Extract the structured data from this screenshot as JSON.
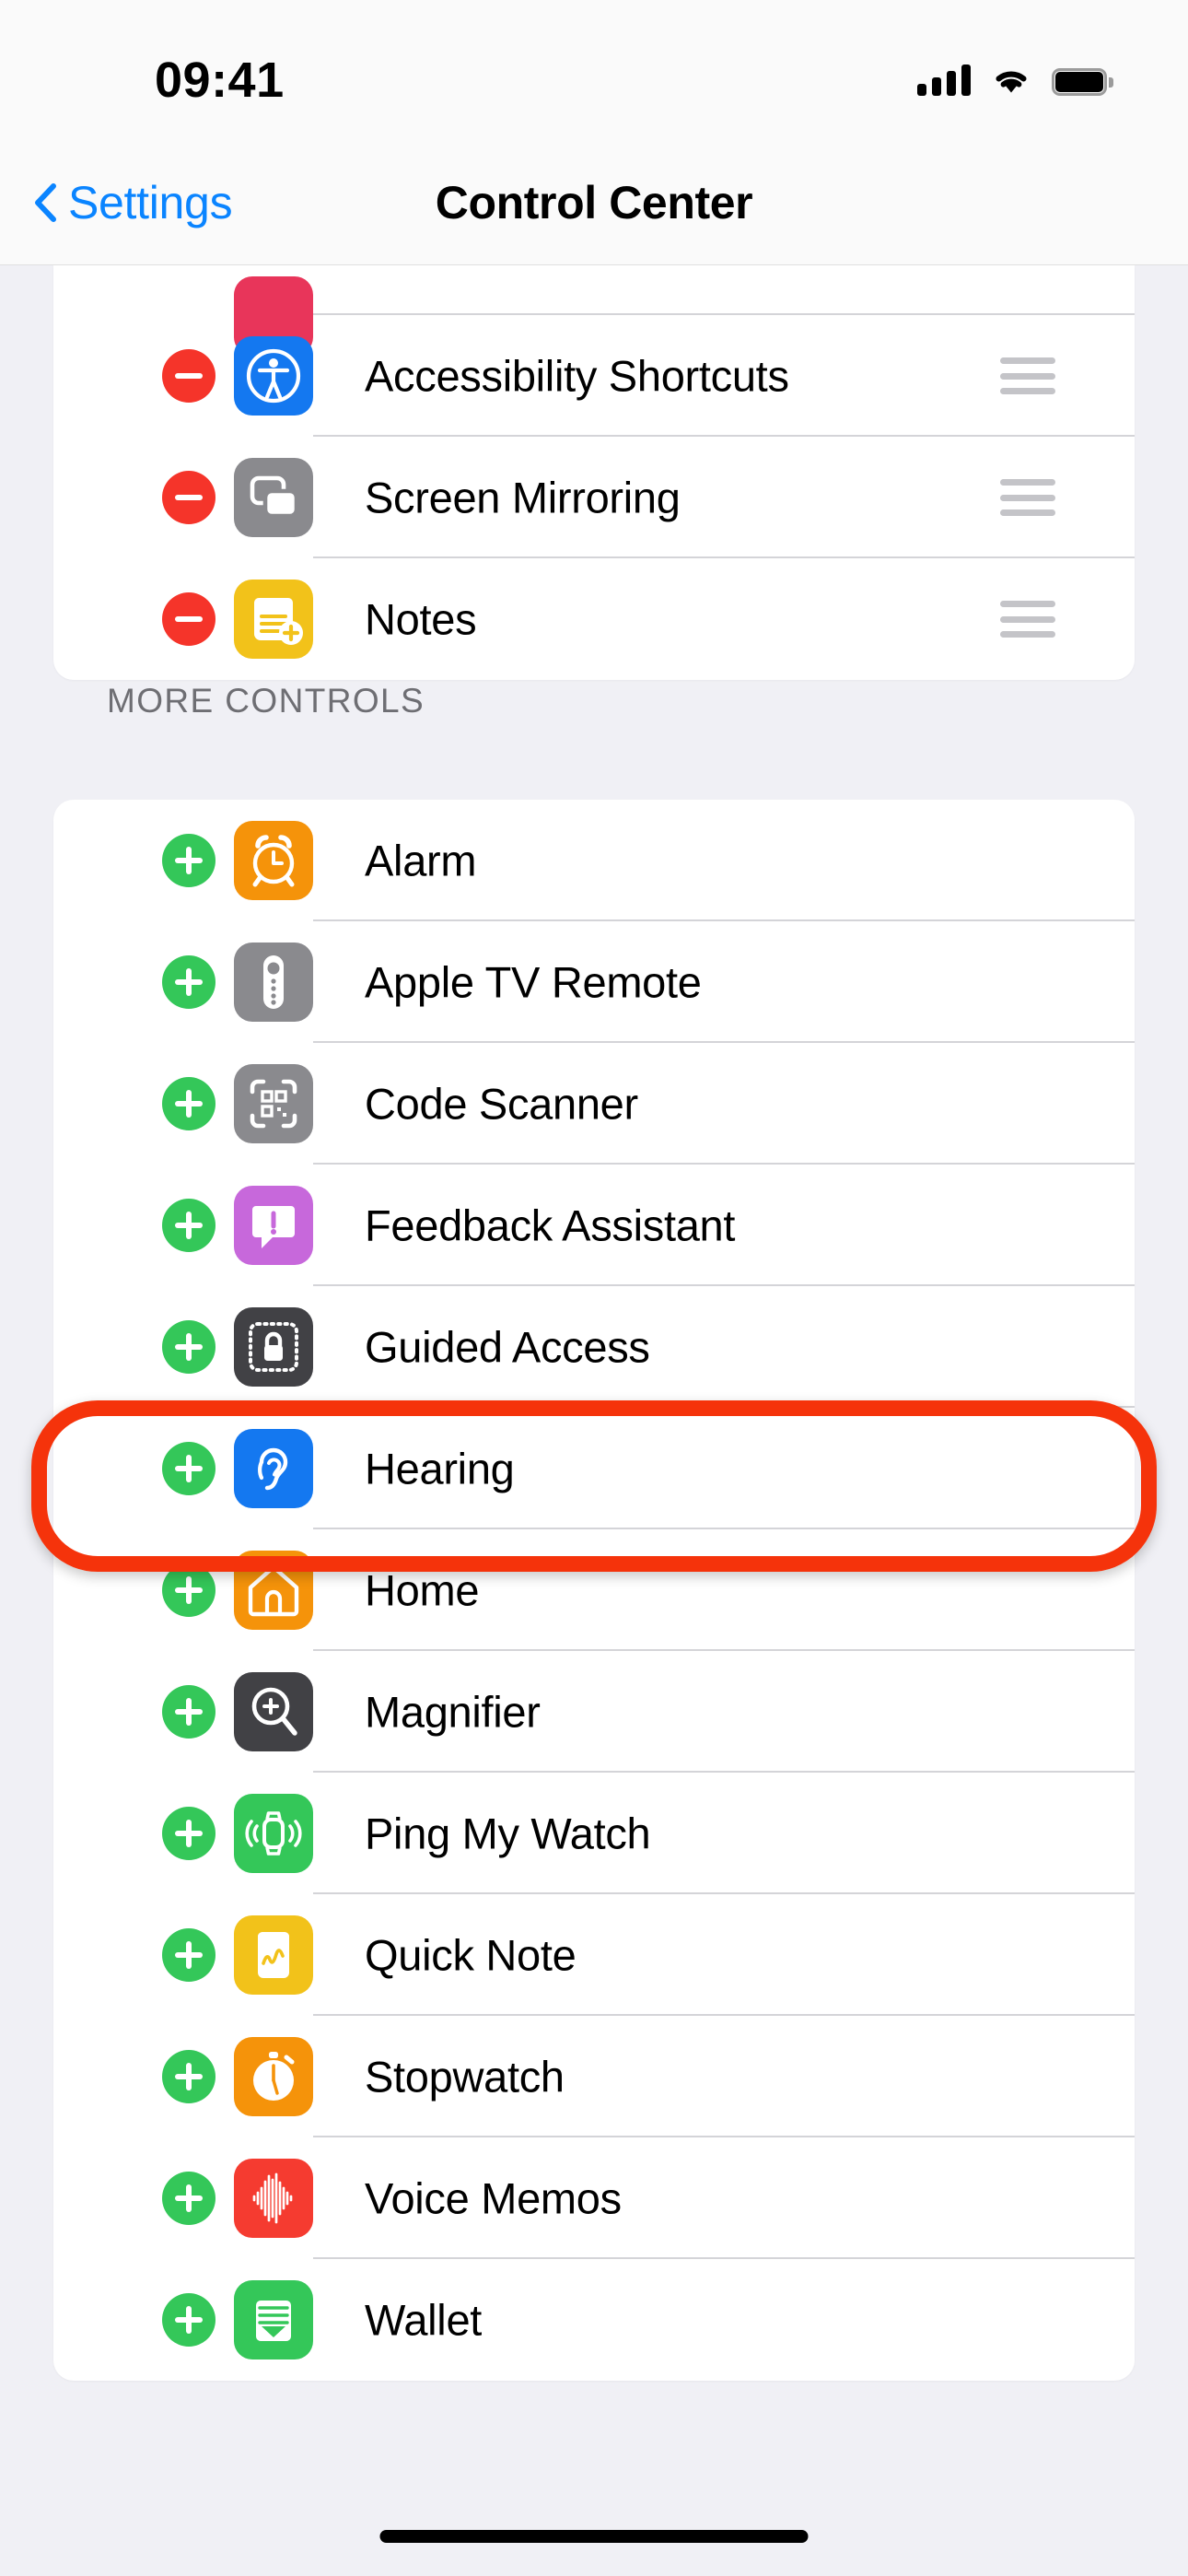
{
  "status_bar": {
    "time": "09:41",
    "cellular_icon": "cellular-signal-icon",
    "wifi_icon": "wifi-icon",
    "battery_icon": "battery-full-icon"
  },
  "nav_bar": {
    "back_label": "Settings",
    "back_icon": "chevron-left-icon",
    "title": "Control Center"
  },
  "included_section": {
    "rows": [
      {
        "label": "",
        "icon": "clipped-pink-icon",
        "icon_color": "#E8355A",
        "action": "remove",
        "clipped": true
      },
      {
        "label": "Accessibility Shortcuts",
        "icon": "accessibility-icon",
        "icon_color": "#1478F0",
        "action": "remove",
        "clipped": false
      },
      {
        "label": "Screen Mirroring",
        "icon": "screen-mirroring-icon",
        "icon_color": "#8A8A8E",
        "action": "remove",
        "clipped": false
      },
      {
        "label": "Notes",
        "icon": "notes-icon",
        "icon_color": "#F2C21A",
        "action": "remove",
        "clipped": false
      }
    ],
    "drag_handle_icon": "drag-handle-icon",
    "remove_icon": "minus-circle-icon"
  },
  "more_controls_section": {
    "header": "MORE CONTROLS",
    "add_icon": "plus-circle-icon",
    "rows": [
      {
        "label": "Alarm",
        "icon": "alarm-clock-icon",
        "icon_color": "#F5930A"
      },
      {
        "label": "Apple TV Remote",
        "icon": "apple-tv-remote-icon",
        "icon_color": "#8A8A8E"
      },
      {
        "label": "Code Scanner",
        "icon": "code-scanner-icon",
        "icon_color": "#8A8A8E"
      },
      {
        "label": "Feedback Assistant",
        "icon": "feedback-assistant-icon",
        "icon_color": "#C768DB"
      },
      {
        "label": "Guided Access",
        "icon": "guided-access-icon",
        "icon_color": "#414145"
      },
      {
        "label": "Hearing",
        "icon": "hearing-ear-icon",
        "icon_color": "#1478F0"
      },
      {
        "label": "Home",
        "icon": "home-house-icon",
        "icon_color": "#F5930A"
      },
      {
        "label": "Magnifier",
        "icon": "magnifier-icon",
        "icon_color": "#414145"
      },
      {
        "label": "Ping My Watch",
        "icon": "ping-my-watch-icon",
        "icon_color": "#34C759"
      },
      {
        "label": "Quick Note",
        "icon": "quick-note-icon",
        "icon_color": "#F2C21A"
      },
      {
        "label": "Stopwatch",
        "icon": "stopwatch-icon",
        "icon_color": "#F5930A"
      },
      {
        "label": "Voice Memos",
        "icon": "voice-memos-icon",
        "icon_color": "#F53B30"
      },
      {
        "label": "Wallet",
        "icon": "wallet-icon",
        "icon_color": "#34C759"
      }
    ]
  },
  "annotation": {
    "target_label": "Hearing",
    "shape": "rounded-rectangle-highlight",
    "color": "#F5330B"
  },
  "home_indicator": "home-indicator",
  "colors": {
    "page_background": "#F0F0F5",
    "card_background": "#FFFFFF",
    "accent_blue": "#0A84FF",
    "add_green": "#34C759",
    "remove_red": "#F5342A",
    "separator": "#D4D4D8",
    "header_text": "#6E6E73"
  }
}
